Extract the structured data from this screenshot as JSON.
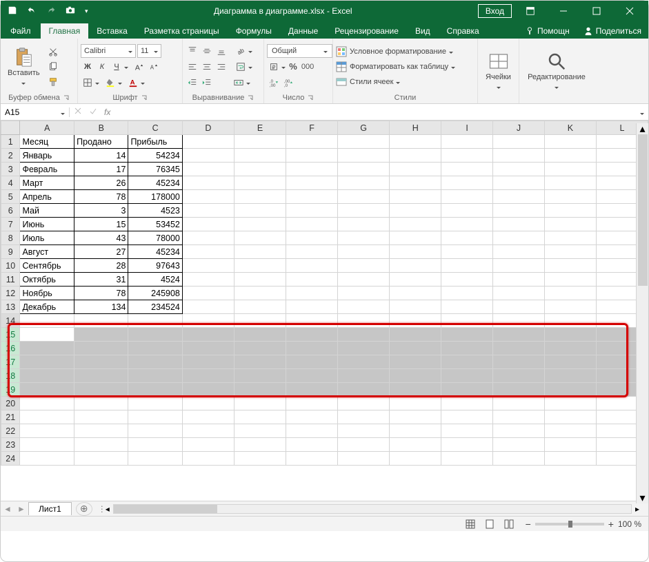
{
  "title": "Диаграмма в диаграмме.xlsx  -  Excel",
  "signin": "Вход",
  "tabs": {
    "file": "Файл",
    "list": [
      "Главная",
      "Вставка",
      "Разметка страницы",
      "Формулы",
      "Данные",
      "Рецензирование",
      "Вид",
      "Справка"
    ],
    "active": 0,
    "help": "Помощн",
    "share": "Поделиться"
  },
  "ribbon": {
    "paste": "Вставить",
    "clipboard": "Буфер обмена",
    "font": {
      "name": "Calibri",
      "size": "11",
      "label": "Шрифт",
      "bold": "Ж",
      "italic": "К",
      "underline": "Ч"
    },
    "alignment": "Выравнивание",
    "number": {
      "label": "Число",
      "format": "Общий"
    },
    "styles": {
      "label": "Стили",
      "cond": "Условное форматирование",
      "table": "Форматировать как таблицу",
      "cell": "Стили ячеек"
    },
    "cells": "Ячейки",
    "editing": "Редактирование"
  },
  "namebox": "A15",
  "sheet": "Лист1",
  "columns": [
    "A",
    "B",
    "C",
    "D",
    "E",
    "F",
    "G",
    "H",
    "I",
    "J",
    "K",
    "L"
  ],
  "headers": [
    "Месяц",
    "Продано",
    "Прибыль"
  ],
  "rows": [
    {
      "m": "Январь",
      "s": 14,
      "p": 54234
    },
    {
      "m": "Февраль",
      "s": 17,
      "p": 76345
    },
    {
      "m": "Март",
      "s": 26,
      "p": 45234
    },
    {
      "m": "Апрель",
      "s": 78,
      "p": 178000
    },
    {
      "m": "Май",
      "s": 3,
      "p": 4523
    },
    {
      "m": "Июнь",
      "s": 15,
      "p": 53452
    },
    {
      "m": "Июль",
      "s": 43,
      "p": 78000
    },
    {
      "m": "Август",
      "s": 27,
      "p": 45234
    },
    {
      "m": "Сентябрь",
      "s": 28,
      "p": 97643
    },
    {
      "m": "Октябрь",
      "s": 31,
      "p": 4524
    },
    {
      "m": "Ноябрь",
      "s": 78,
      "p": 245908
    },
    {
      "m": "Декабрь",
      "s": 134,
      "p": 234524
    }
  ],
  "zoom": "100 %",
  "selection": {
    "startRow": 15,
    "endRow": 19
  }
}
